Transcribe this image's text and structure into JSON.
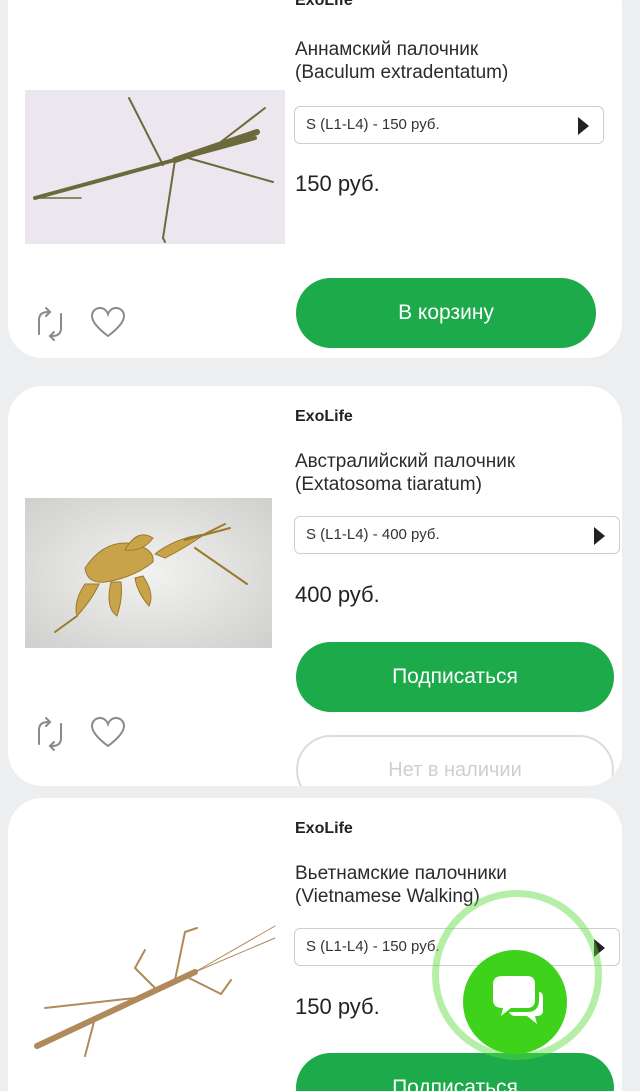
{
  "products": [
    {
      "brand": "ExoLife",
      "title_line1": "Аннамский палочник",
      "title_line2": "(Baculum extradentatum)",
      "variant": "S (L1-L4) - 150 руб.",
      "price": "150 руб.",
      "action": "В корзину"
    },
    {
      "brand": "ExoLife",
      "title_line1": "Австралийский палочник",
      "title_line2": "(Extatosoma tiaratum)",
      "variant": "S (L1-L4) - 400 руб.",
      "price": "400 руб.",
      "action": "Подписаться",
      "availability": "Нет в наличии"
    },
    {
      "brand": "ExoLife",
      "title_line1": "Вьетнамские палочники",
      "title_line2": "(Vietnamese Walking)",
      "variant": "S (L1-L4) - 150 руб.",
      "price": "150 руб.",
      "action": "Подписаться"
    }
  ],
  "icons": {
    "compare": "refresh-icon",
    "favorite": "heart-icon",
    "chat": "chat-bubbles-icon",
    "select_arrow": "triangle-right-icon"
  },
  "colors": {
    "accent_green": "#1daa4a",
    "chat_green": "#3ed21b",
    "background": "#eceef0"
  }
}
